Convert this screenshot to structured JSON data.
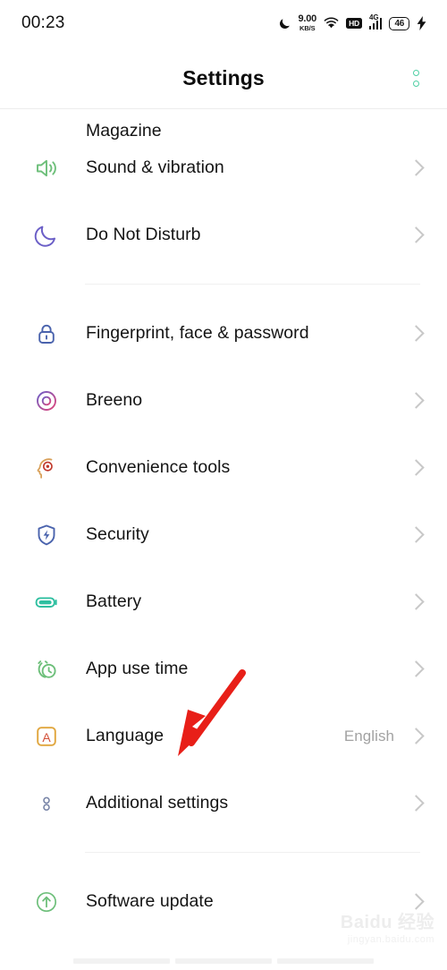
{
  "status_bar": {
    "clock": "00:23",
    "net_speed_value": "9.00",
    "net_speed_unit": "KB/S",
    "dnd_icon": "moon-icon",
    "wifi_icon": "wifi-icon",
    "hd_label": "HD",
    "network_type": "4G",
    "battery_level": "46",
    "charging_icon": "lightning-bolt-icon"
  },
  "header": {
    "title": "Settings",
    "overflow_icon": "more-options-icon",
    "accent_color": "#4ecfa4"
  },
  "clipped_item": {
    "label": "Magazine"
  },
  "groups": [
    {
      "items": [
        {
          "label": "Sound & vibration",
          "icon": "speaker-icon",
          "icon_color": "#6dbf7a",
          "value": ""
        },
        {
          "label": "Do Not Disturb",
          "icon": "moon-icon",
          "icon_color": "#6b5fc7",
          "value": ""
        }
      ]
    },
    {
      "items": [
        {
          "label": "Fingerprint, face & password",
          "icon": "lock-icon",
          "icon_color": "#4a63ad",
          "value": ""
        },
        {
          "label": "Breeno",
          "icon": "breeno-circle-icon",
          "icon_color": "#c8427e",
          "value": ""
        },
        {
          "label": "Convenience tools",
          "icon": "head-target-icon",
          "icon_color": "#d9a15a",
          "value": ""
        },
        {
          "label": "Security",
          "icon": "shield-bolt-icon",
          "icon_color": "#4a63ad",
          "value": ""
        },
        {
          "label": "Battery",
          "icon": "battery-icon",
          "icon_color": "#2fbfa0",
          "value": ""
        },
        {
          "label": "App use time",
          "icon": "alarm-clock-icon",
          "icon_color": "#6dbf7a",
          "value": ""
        },
        {
          "label": "Language",
          "icon": "language-a-icon",
          "icon_color": "#e0a53c",
          "value": "English"
        },
        {
          "label": "Additional settings",
          "icon": "two-dots-icon",
          "icon_color": "#7a86a8",
          "value": ""
        }
      ]
    },
    {
      "items": [
        {
          "label": "Software update",
          "icon": "update-arrow-icon",
          "icon_color": "#6dbf7a",
          "value": ""
        }
      ]
    }
  ],
  "annotation": {
    "arrow_color": "#e81f18",
    "arrow_name": "red-pointer-arrow",
    "points_at": "Language"
  },
  "watermark": {
    "main": "Baidu 经验",
    "sub": "jingyan.baidu.com"
  }
}
